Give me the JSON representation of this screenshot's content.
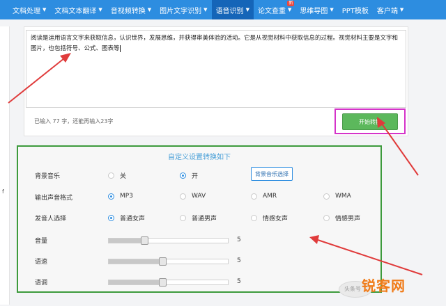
{
  "nav": {
    "items": [
      {
        "label": "文档处理",
        "caret": "▼"
      },
      {
        "label": "文档文本翻译",
        "caret": "▼"
      },
      {
        "label": "音视频转换",
        "caret": "▼"
      },
      {
        "label": "图片文字识别",
        "caret": "▼"
      },
      {
        "label": "语音识别",
        "caret": "▼",
        "active": true
      },
      {
        "label": "论文查重",
        "caret": "▼",
        "badge": "新"
      },
      {
        "label": "思维导图",
        "caret": "▼"
      },
      {
        "label": "PPT模板",
        "caret": ""
      },
      {
        "label": "客户端",
        "caret": "▼"
      }
    ]
  },
  "left_panel": {
    "fragment": "f"
  },
  "editor": {
    "text": "阅读是运用语言文字来获取信息，认识世界，发展思维，并获得审美体验的活动。它是从视觉材料中获取信息的过程。视觉材料主要是文字和图片，也包括符号、公式、图表等",
    "counter": "已输入 77 字，还能再输入23字",
    "convert_button": "开始转换"
  },
  "settings": {
    "title": "自定义设置转换如下",
    "bg_music": {
      "label": "背景音乐",
      "options": [
        "关",
        "开"
      ],
      "selected": 1,
      "select_button": "背景音乐选择"
    },
    "format": {
      "label": "输出声音格式",
      "options": [
        "MP3",
        "WAV",
        "AMR",
        "WMA"
      ],
      "selected": 0
    },
    "voice": {
      "label": "发音人选择",
      "options": [
        "普通女声",
        "普通男声",
        "情感女声",
        "情感男声"
      ],
      "selected": 0
    },
    "volume": {
      "label": "音量",
      "value": "5",
      "fraction": 0.3
    },
    "speed": {
      "label": "语速",
      "value": "5",
      "fraction": 0.45
    },
    "pitch": {
      "label": "语调",
      "value": "5",
      "fraction": 0.45
    }
  },
  "watermark": {
    "text": "锐客网",
    "sub": "头条号"
  },
  "colors": {
    "nav": "#2d8de0",
    "nav_active": "#1565b8",
    "button": "#5cb85c",
    "highlight_box": "#d533c9",
    "settings_border": "#3c9a3c",
    "arrow": "#e03b3b",
    "watermark": "#f07c1a"
  }
}
